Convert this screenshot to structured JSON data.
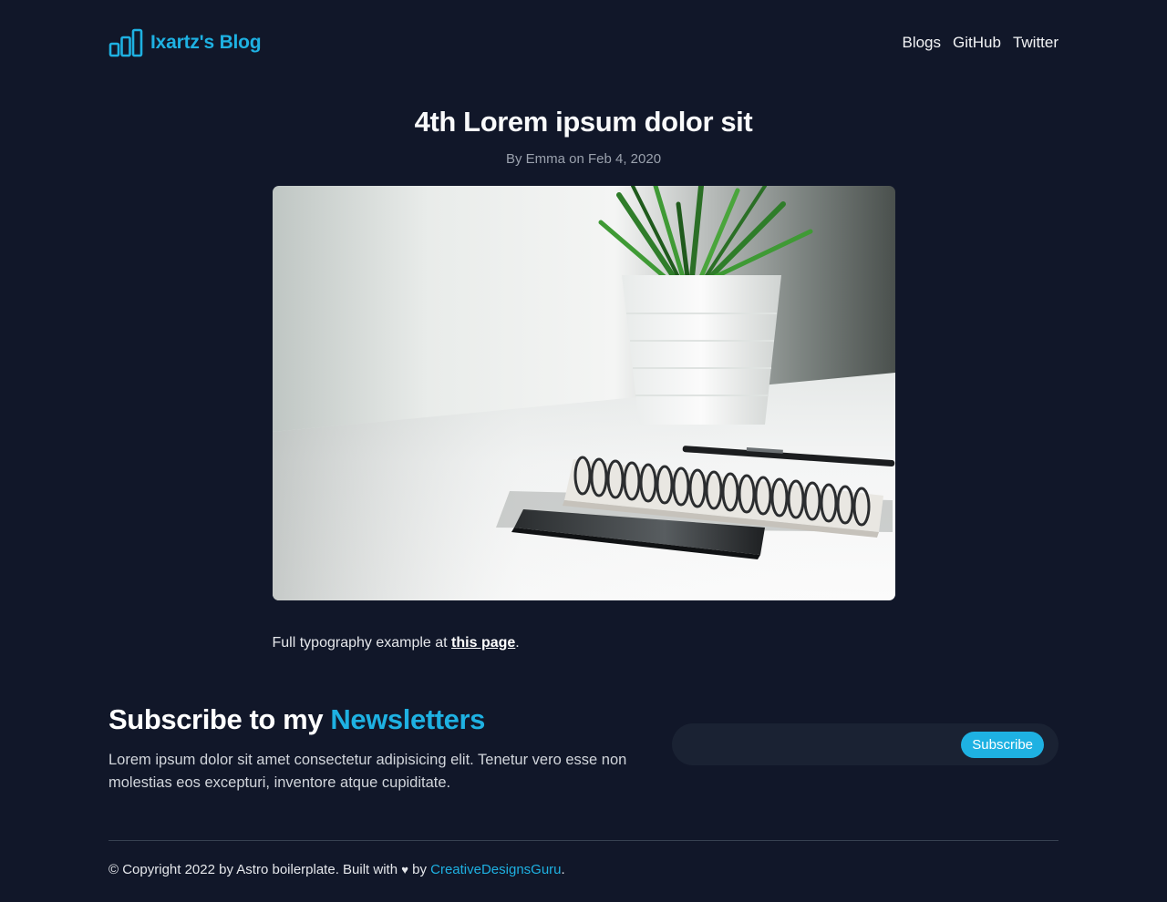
{
  "header": {
    "logo_text": "Ixartz's Blog",
    "logo_icon": "bar-chart-icon",
    "nav": [
      {
        "label": "Blogs"
      },
      {
        "label": "GitHub"
      },
      {
        "label": "Twitter"
      }
    ]
  },
  "post": {
    "title": "4th Lorem ipsum dolor sit",
    "meta": "By Emma on Feb 4, 2020",
    "image_subject": "desk with plant, notebook, pen and phone",
    "body_prefix": "Full typography example at ",
    "body_link": "this page",
    "body_suffix": "."
  },
  "newsletter": {
    "title_prefix": "Subscribe to my ",
    "title_accent": "Newsletters",
    "description": "Lorem ipsum dolor sit amet consectetur adipisicing elit. Tenetur vero esse non molestias eos excepturi, inventore atque cupiditate.",
    "input_placeholder": "",
    "button_label": "Subscribe"
  },
  "footer": {
    "prefix": "© Copyright 2022 by Astro boilerplate. Built with ",
    "heart_icon": "heart-icon",
    "heart": "♥",
    "by": " by ",
    "link": "CreativeDesignsGuru",
    "suffix": "."
  },
  "colors": {
    "background": "#111729",
    "accent": "#1eb1e2",
    "input_bg": "#1a2233"
  }
}
